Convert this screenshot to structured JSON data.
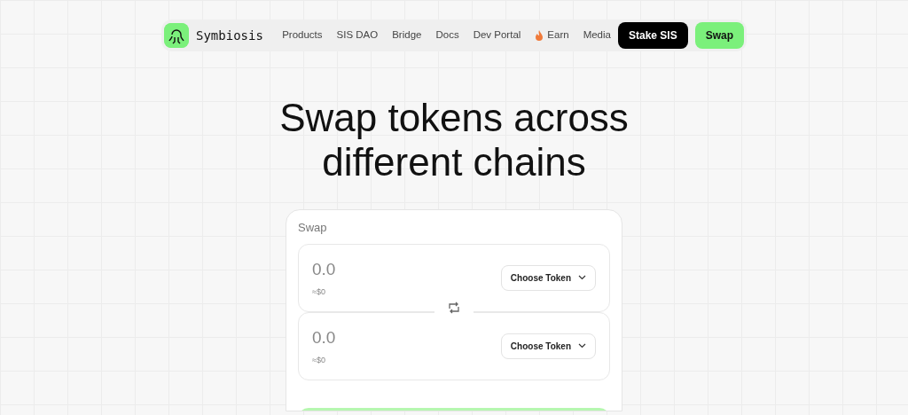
{
  "brand": {
    "name": "Symbiosis"
  },
  "nav": [
    {
      "label": "Products",
      "kind": "plain"
    },
    {
      "label": "SIS DAO",
      "kind": "plain"
    },
    {
      "label": "Bridge",
      "kind": "plain"
    },
    {
      "label": "Docs",
      "kind": "plain"
    },
    {
      "label": "Dev Portal",
      "kind": "plain"
    },
    {
      "label": "Earn",
      "kind": "hot"
    },
    {
      "label": "Media",
      "kind": "plain"
    }
  ],
  "actions": [
    {
      "label": "Stake SIS",
      "kind": "dark"
    },
    {
      "label": "Swap",
      "kind": "green"
    }
  ],
  "headline": [
    "Swap tokens across",
    "different chains"
  ],
  "swap": {
    "title": "Swap",
    "fields": [
      {
        "placeholder": "0.0",
        "usd": "≈$0",
        "token_button": "Choose Token"
      },
      {
        "placeholder": "0.0",
        "usd": "≈$0",
        "token_button": "Choose Token"
      }
    ]
  }
}
